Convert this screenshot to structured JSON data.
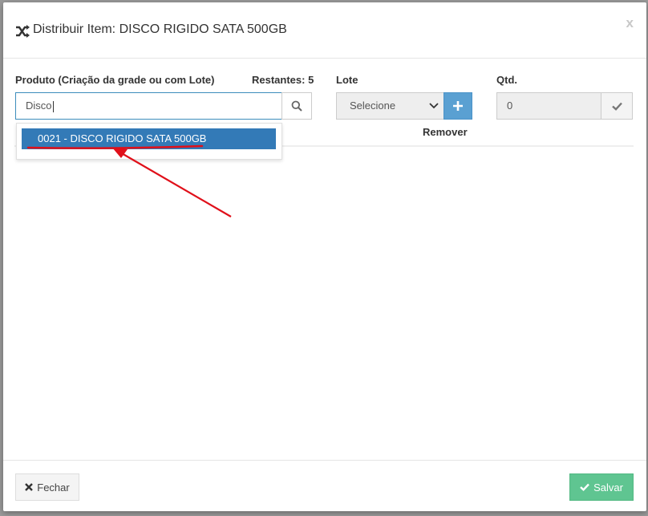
{
  "modal": {
    "title": "Distribuir Item: DISCO RIGIDO SATA 500GB",
    "close_label": "x"
  },
  "form": {
    "produto_label": "Produto (Criação da grade ou com Lote)",
    "restantes_label": "Restantes: 5",
    "produto_value": "Disco",
    "lote_label": "Lote",
    "lote_selected": "Selecione",
    "qtd_label": "Qtd.",
    "qtd_value": "0"
  },
  "autocomplete": {
    "items": [
      "0021 - DISCO RIGIDO SATA 500GB"
    ]
  },
  "table": {
    "headers": [
      "Remover"
    ]
  },
  "footer": {
    "close_button": "Fechar",
    "save_button": "Salvar"
  },
  "colors": {
    "primary": "#337ab7",
    "success": "#5fc591",
    "annotation": "#e0101a"
  },
  "icons": [
    "shuffle-icon",
    "search-icon",
    "plus-icon",
    "check-icon",
    "times-icon",
    "chevron-down-icon"
  ]
}
